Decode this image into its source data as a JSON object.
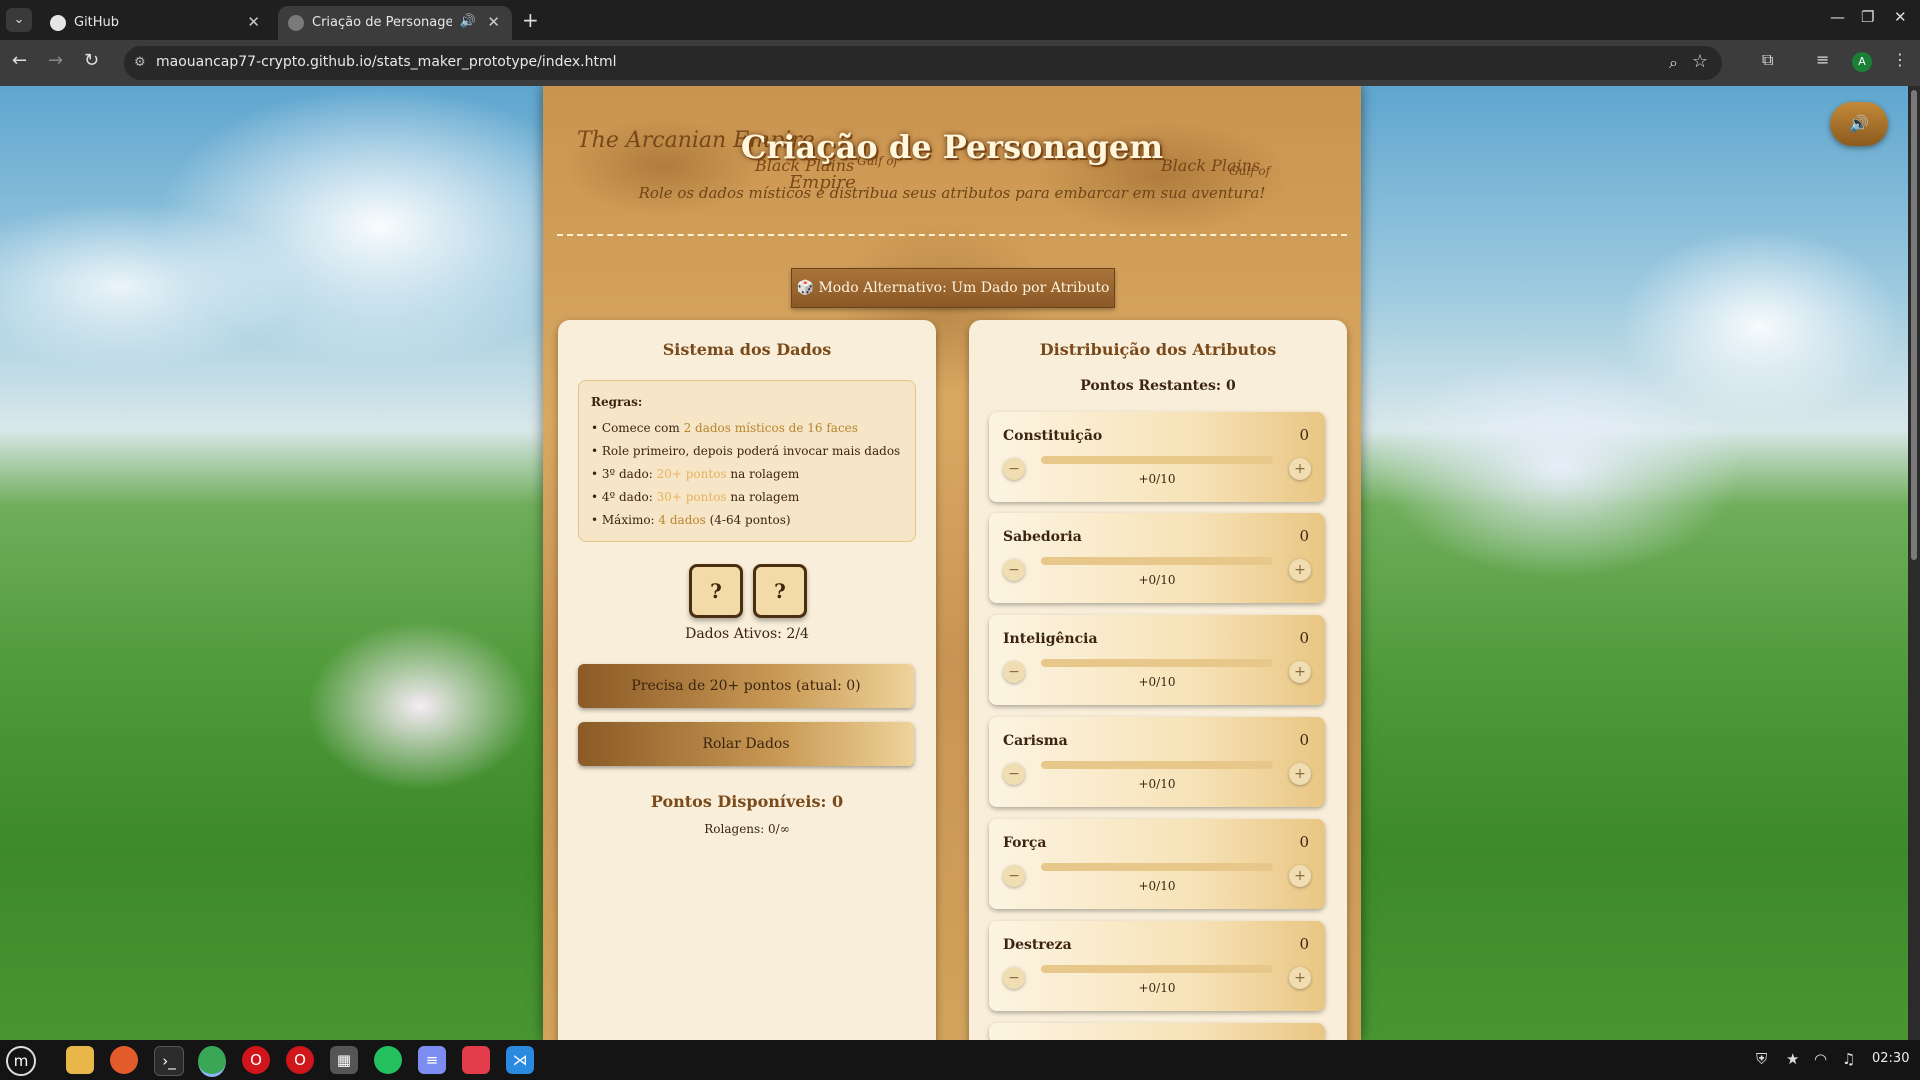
{
  "browser": {
    "tabs": [
      {
        "title": "GitHub",
        "active": false
      },
      {
        "title": "Criação de Personagem -",
        "active": true
      }
    ],
    "url": "maouancap77-crypto.github.io/stats_maker_prototype/index.html",
    "profile_initial": "A"
  },
  "page": {
    "title": "Criação de Personagem",
    "subtitle": "Role os dados místicos e distribua seus atributos para embarcar em sua aventura!",
    "map_labels": [
      "The Arcanian Empire",
      "Black Plains",
      "Black Plains",
      "Gulf of",
      "Gulf of",
      "Empire"
    ],
    "alt_mode_button": "🎲 Modo Alternativo: Um Dado por Atributo",
    "sound_icon": "speaker-icon"
  },
  "dice_system": {
    "title": "Sistema dos Dados",
    "rules_heading": "Regras:",
    "rules": [
      {
        "pre": "• Comece com ",
        "hl": "2 dados místicos de 16 faces",
        "post": ""
      },
      {
        "pre": "• Role primeiro, depois poderá invocar mais dados",
        "hl": "",
        "post": ""
      },
      {
        "pre": "• 3º dado: ",
        "hl": "20+ pontos",
        "post": " na rolagem"
      },
      {
        "pre": "• 4º dado: ",
        "hl": "30+ pontos",
        "post": " na rolagem"
      },
      {
        "pre": "• Máximo: ",
        "hl": "4 dados",
        "post": " (4-64 pontos)"
      }
    ],
    "dice": [
      "?",
      "?"
    ],
    "active_dice": "Dados Ativos: 2/4",
    "summon_button": "Precisa de 20+ pontos (atual: 0)",
    "roll_button": "Rolar Dados",
    "points_available": "Pontos Disponíveis: 0",
    "rolls": "Rolagens: 0/∞"
  },
  "attributes": {
    "title": "Distribuição dos Atributos",
    "remaining": "Pontos Restantes: 0",
    "items": [
      {
        "name": "Constituição",
        "value": "0",
        "bonus": "+0/10",
        "fill": 0
      },
      {
        "name": "Sabedoria",
        "value": "0",
        "bonus": "+0/10",
        "fill": 0
      },
      {
        "name": "Inteligência",
        "value": "0",
        "bonus": "+0/10",
        "fill": 0
      },
      {
        "name": "Carisma",
        "value": "0",
        "bonus": "+0/10",
        "fill": 0
      },
      {
        "name": "Força",
        "value": "0",
        "bonus": "+0/10",
        "fill": 0
      },
      {
        "name": "Destreza",
        "value": "0",
        "bonus": "+0/10",
        "fill": 0
      }
    ]
  },
  "taskbar": {
    "clock": "02:30"
  },
  "colors": {
    "accent": "#7a4a1a",
    "parchment": "#f8eed9",
    "highlight": "#b8842e"
  }
}
